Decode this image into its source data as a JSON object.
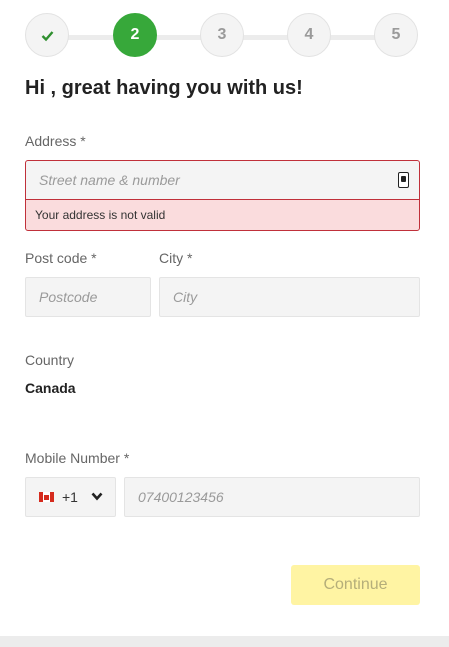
{
  "stepper": {
    "steps": [
      {
        "label": "",
        "state": "done",
        "icon": "check-icon"
      },
      {
        "label": "2",
        "state": "active"
      },
      {
        "label": "3",
        "state": "pending"
      },
      {
        "label": "4",
        "state": "pending"
      },
      {
        "label": "5",
        "state": "pending"
      }
    ],
    "active_color": "#37a83a"
  },
  "greeting": "Hi , great having you with us!",
  "address": {
    "label": "Address *",
    "placeholder": "Street name & number",
    "value": "",
    "error": "Your address is not valid",
    "icon": "address-book-icon",
    "error_color": "#c0303a"
  },
  "postcode": {
    "label": "Post code *",
    "placeholder": "Postcode",
    "value": ""
  },
  "city": {
    "label": "City *",
    "placeholder": "City",
    "value": ""
  },
  "country": {
    "label": "Country",
    "value": "Canada"
  },
  "mobile": {
    "label": "Mobile Number *",
    "country_code": "+1",
    "flag": "canada-flag-icon",
    "placeholder": "07400123456",
    "value": ""
  },
  "continue_label": "Continue",
  "continue_color": "#fff4a3"
}
